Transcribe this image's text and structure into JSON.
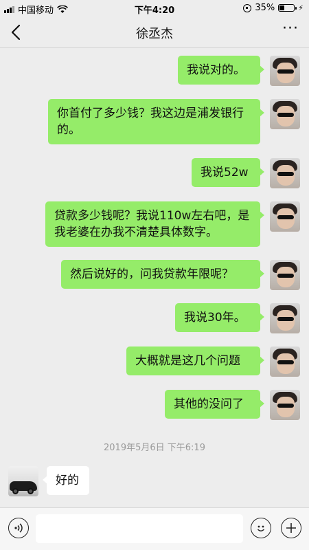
{
  "status_bar": {
    "carrier": "中国移动",
    "time": "下午4:20",
    "battery": "35%",
    "battery_level": 0.35
  },
  "nav": {
    "title": "徐丞杰",
    "back_icon": "chevron-left-icon",
    "more_icon": "more-dots-icon"
  },
  "messages": [
    {
      "side": "out",
      "text": "我说对的。"
    },
    {
      "side": "out",
      "text": "你首付了多少钱？我这边是浦发银行的。"
    },
    {
      "side": "out",
      "text": "我说52w"
    },
    {
      "side": "out",
      "text": "贷款多少钱呢？我说110w左右吧，是我老婆在办我不清楚具体数字。"
    },
    {
      "side": "out",
      "text": "然后说好的，问我贷款年限呢？"
    },
    {
      "side": "out",
      "text": "我说30年。"
    },
    {
      "side": "out",
      "text": "大概就是这几个问题"
    },
    {
      "side": "out",
      "text": "其他的没问了"
    },
    {
      "side": "in",
      "text": "好的"
    }
  ],
  "timestamp": "2019年5月6日 下午6:19",
  "input_bar": {
    "value": "",
    "voice_icon": "voice-icon",
    "emoji_icon": "emoji-icon",
    "plus_icon": "plus-icon"
  }
}
